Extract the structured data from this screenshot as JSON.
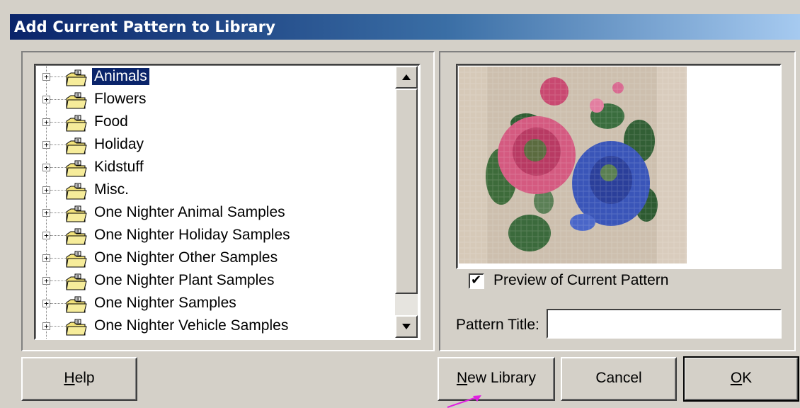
{
  "window": {
    "title": "Add Current Pattern to Library"
  },
  "library_tree": {
    "items": [
      {
        "label": "Animals",
        "selected": true
      },
      {
        "label": "Flowers"
      },
      {
        "label": "Food"
      },
      {
        "label": "Holiday"
      },
      {
        "label": "Kidstuff"
      },
      {
        "label": "Misc."
      },
      {
        "label": "One Nighter Animal Samples"
      },
      {
        "label": "One Nighter Holiday Samples"
      },
      {
        "label": "One Nighter Other Samples"
      },
      {
        "label": "One Nighter Plant Samples"
      },
      {
        "label": "One Nighter Samples"
      },
      {
        "label": "One Nighter Vehicle Samples"
      }
    ],
    "expander_glyph": "+",
    "folder_icon": "folder-icon"
  },
  "preview": {
    "checkbox_label": "Preview of Current Pattern",
    "checked": true,
    "check_glyph": "✔"
  },
  "pattern_title": {
    "label": "Pattern Title:",
    "value": ""
  },
  "buttons": {
    "help": "Help",
    "help_mnemonic": "H",
    "new_library": "New Library",
    "new_library_mnemonic": "N",
    "cancel": "Cancel",
    "ok": "OK",
    "ok_mnemonic": "O"
  },
  "colors": {
    "title_start": "#0a246a",
    "title_end": "#a6caf0",
    "selection": "#0a246a",
    "annotation_arrow": "#e020e0"
  }
}
